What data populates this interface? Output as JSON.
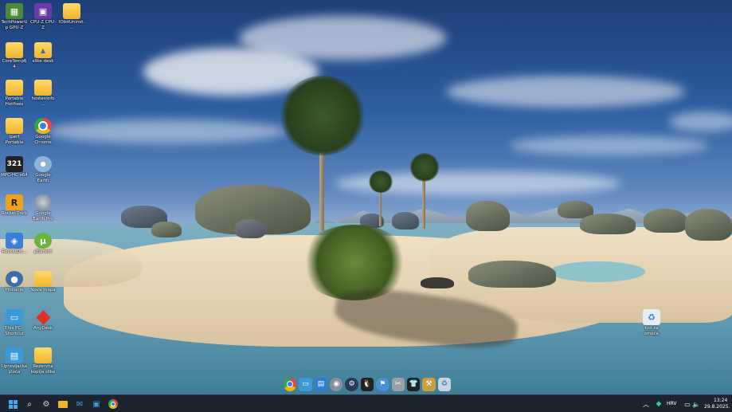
{
  "desktop_icons": [
    {
      "id": "techpowerup-gpuz",
      "label": "TechPowerUp GPU-Z",
      "icon": "gpuz-icon",
      "color": "#4a8a3a"
    },
    {
      "id": "cpuz",
      "label": "CPU-Z CPU-Z",
      "icon": "cpuz-icon",
      "color": "#6a3aa8"
    },
    {
      "id": "iobit-uninstaller",
      "label": "IObitUninst...",
      "icon": "folder-icon",
      "color": "#f0b429"
    },
    {
      "id": "coretemp",
      "label": "CoreTemp64",
      "icon": "folder-icon",
      "color": "#f0b429"
    },
    {
      "id": "slike-desk",
      "label": "slike desk",
      "icon": "image-folder-icon",
      "color": "#f0b429"
    },
    {
      "id": "firefox-portable",
      "label": "Portable Hotfixes",
      "icon": "folder-icon",
      "color": "#f0b429"
    },
    {
      "id": "hosteninfo",
      "label": "hosteninfo ...",
      "icon": "folder-icon",
      "color": "#f0b429"
    },
    {
      "id": "iperf-portable",
      "label": "iperf Portable",
      "icon": "folder-icon",
      "color": "#f0b429"
    },
    {
      "id": "google-chrome",
      "label": "Google Chrome",
      "icon": "chrome-icon",
      "color": "#e8453c"
    },
    {
      "id": "mpc-hc",
      "label": "MPC-HC x64",
      "icon": "mpc-hc-icon",
      "color": "#222222"
    },
    {
      "id": "google-earth",
      "label": "Google Earth",
      "icon": "cd-icon",
      "color": "#8ab4d8"
    },
    {
      "id": "rocketdock",
      "label": "RocketDock",
      "icon": "rocketdock-icon",
      "color": "#f0a020"
    },
    {
      "id": "google-earth-pro",
      "label": "Google Earth Pro",
      "icon": "google-earth-pro-icon",
      "color": "#707a86"
    },
    {
      "id": "rocketdock-2",
      "label": "RocketDo...",
      "icon": "rocketdock-alt-icon",
      "color": "#3c7fd8"
    },
    {
      "id": "utorrent",
      "label": "µTorrent",
      "icon": "utorrent-icon",
      "color": "#6ab63d"
    },
    {
      "id": "pinnacle",
      "label": "Pinnacle",
      "icon": "pinnacle-icon",
      "color": "#3d6da8"
    },
    {
      "id": "nova-mapa",
      "label": "Nova mapa",
      "icon": "folder-icon",
      "color": "#f0b429"
    },
    {
      "id": "this-pc",
      "label": "This PC - Shortcut",
      "icon": "monitor-icon",
      "color": "#3c9ad8"
    },
    {
      "id": "anydesk",
      "label": "AnyDesk",
      "icon": "anydesk-icon",
      "color": "#e0302c"
    },
    {
      "id": "upravljacka-ploca",
      "label": "Upravljačka ploča",
      "icon": "control-panel-icon",
      "color": "#3c9ad8"
    },
    {
      "id": "rezervna-kopija",
      "label": "Rezervna kopija slike",
      "icon": "folder-icon",
      "color": "#f0b429"
    }
  ],
  "recycle_bin": {
    "label": "Koš za smeće",
    "icon": "recycle-bin-icon"
  },
  "dock_items": [
    {
      "name": "chrome",
      "icon": "chrome-icon",
      "color": "#e8453c"
    },
    {
      "name": "monitor",
      "icon": "monitor-icon",
      "color": "#3c9ad8"
    },
    {
      "name": "control-panel",
      "icon": "control-panel-icon",
      "color": "#2d7fd0"
    },
    {
      "name": "drive",
      "icon": "drive-icon",
      "color": "#8a8f9a"
    },
    {
      "name": "steam",
      "icon": "steam-icon",
      "color": "#2a3b55"
    },
    {
      "name": "linux",
      "icon": "linux-icon",
      "color": "#222222"
    },
    {
      "name": "network",
      "icon": "network-icon",
      "color": "#4a90d9"
    },
    {
      "name": "tools",
      "icon": "tools-icon",
      "color": "#9aa0a8"
    },
    {
      "name": "tshirt",
      "icon": "tshirt-icon",
      "color": "#222222"
    },
    {
      "name": "hammer",
      "icon": "hammer-icon",
      "color": "#c8a040"
    },
    {
      "name": "recycle",
      "icon": "recycle-bin-icon",
      "color": "#c8d4e0"
    }
  ],
  "taskbar": {
    "pinned": [
      {
        "name": "start",
        "icon": "windows-start-icon",
        "color": "#3fa9f5"
      },
      {
        "name": "search",
        "icon": "search-icon",
        "color": "#ffffff"
      },
      {
        "name": "settings",
        "icon": "gear-icon",
        "color": "#cfd8e0"
      },
      {
        "name": "file-explorer",
        "icon": "file-explorer-icon",
        "color": "#f0b429"
      },
      {
        "name": "mail",
        "icon": "mail-icon",
        "color": "#3c9ad8"
      },
      {
        "name": "remote",
        "icon": "remote-desktop-icon",
        "color": "#3c9ad8"
      },
      {
        "name": "chrome",
        "icon": "chrome-icon",
        "color": "#e8453c"
      }
    ],
    "tray": {
      "language": "HRV",
      "time": "13:24",
      "date": "29.8.2025."
    }
  }
}
